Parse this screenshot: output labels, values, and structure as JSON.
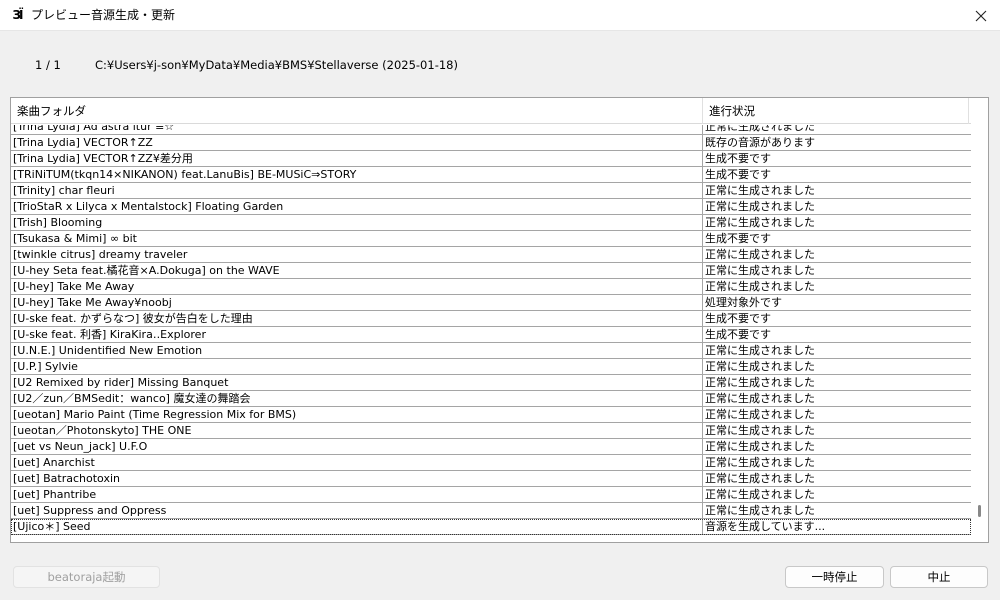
{
  "window": {
    "title": "プレビュー音源生成・更新",
    "app_icon_text": "ЗЇ"
  },
  "header": {
    "progress": "1 / 1",
    "path": "C:¥Users¥j-son¥MyData¥Media¥BMS¥Stellaverse (2025-01-18)"
  },
  "table": {
    "columns": [
      "楽曲フォルダ",
      "進行状況"
    ],
    "rows": [
      {
        "folder": "[Trina Lydia] Ad astra itur ≡☆",
        "status": "正常に生成されました"
      },
      {
        "folder": "[Trina Lydia] VECTOR↑ZZ",
        "status": "既存の音源があります"
      },
      {
        "folder": "[Trina Lydia] VECTOR↑ZZ¥差分用",
        "status": "生成不要です"
      },
      {
        "folder": "[TRiNiTUM(tkqn14×NIKANON) feat.LanuBis] BE-MUSiC⇒STORY",
        "status": "生成不要です"
      },
      {
        "folder": "[Trinity] char fleuri",
        "status": "正常に生成されました"
      },
      {
        "folder": "[TrioStaR x Lilyca x Mentalstock] Floating Garden",
        "status": "正常に生成されました"
      },
      {
        "folder": "[Trish] Blooming",
        "status": "正常に生成されました"
      },
      {
        "folder": "[Tsukasa & Mimi] ∞ bit",
        "status": "生成不要です"
      },
      {
        "folder": "[twinkle citrus] dreamy traveler",
        "status": "正常に生成されました"
      },
      {
        "folder": "[U-hey Seta feat.橘花音×A.Dokuga] on the WAVE",
        "status": "正常に生成されました"
      },
      {
        "folder": "[U-hey] Take Me Away",
        "status": "正常に生成されました"
      },
      {
        "folder": "[U-hey] Take Me Away¥noobj",
        "status": "処理対象外です"
      },
      {
        "folder": "[U-ske feat. かずらなつ] 彼女が告白をした理由",
        "status": "生成不要です"
      },
      {
        "folder": "[U-ske feat. 利香] KiraKira‥Explorer",
        "status": "生成不要です"
      },
      {
        "folder": "[U.N.E.] Unidentified New Emotion",
        "status": "正常に生成されました"
      },
      {
        "folder": "[U.P.] Sylvie",
        "status": "正常に生成されました"
      },
      {
        "folder": "[U2 Remixed by rider] Missing Banquet",
        "status": "正常に生成されました"
      },
      {
        "folder": "[U2／zun／BMSedit：wanco] 魔女達の舞踏会",
        "status": "正常に生成されました"
      },
      {
        "folder": "[ueotan] Mario Paint (Time Regression Mix for BMS)",
        "status": "正常に生成されました"
      },
      {
        "folder": "[ueotan／Photonskyto] THE ONE",
        "status": "正常に生成されました"
      },
      {
        "folder": "[uet vs Neun_jack] U.F.O",
        "status": "正常に生成されました"
      },
      {
        "folder": "[uet] Anarchist",
        "status": "正常に生成されました"
      },
      {
        "folder": "[uet] Batrachotoxin",
        "status": "正常に生成されました"
      },
      {
        "folder": "[uet] Phantribe",
        "status": "正常に生成されました"
      },
      {
        "folder": "[uet] Suppress and Oppress",
        "status": "正常に生成されました"
      },
      {
        "folder": "[Ujico＊] Seed",
        "status": "音源を生成しています..."
      }
    ]
  },
  "buttons": {
    "launch": "beatoraja起動",
    "pause": "一時停止",
    "stop": "中止"
  }
}
